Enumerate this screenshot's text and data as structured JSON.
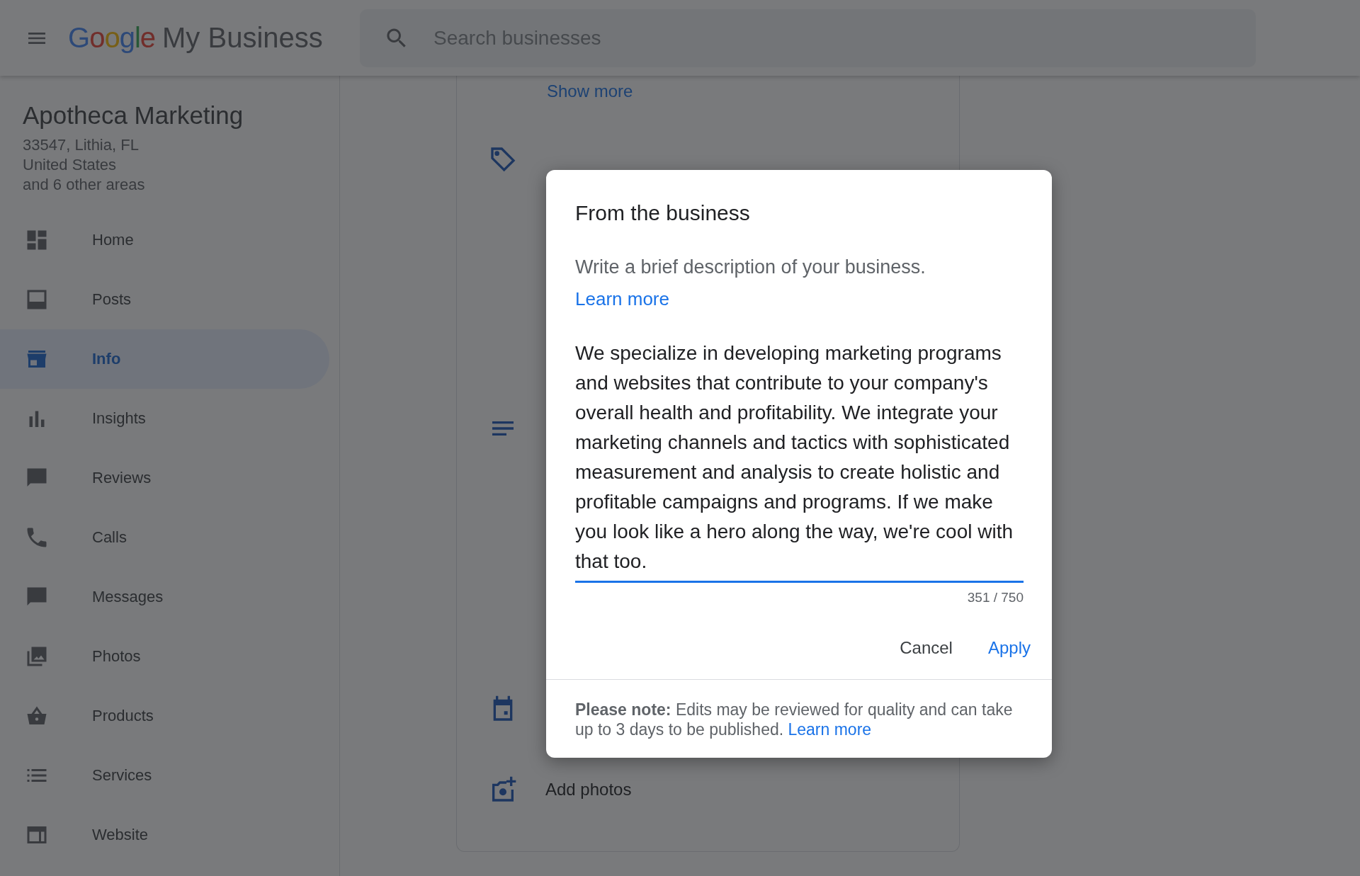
{
  "header": {
    "logo": {
      "brand": "Google",
      "product": "My Business"
    },
    "search": {
      "placeholder": "Search businesses"
    }
  },
  "business": {
    "name": "Apotheca Marketing",
    "address_lines": [
      "33547, Lithia, FL",
      "United States",
      "and 6 other areas"
    ]
  },
  "nav": [
    {
      "label": "Home",
      "selected": false
    },
    {
      "label": "Posts",
      "selected": false
    },
    {
      "label": "Info",
      "selected": true
    },
    {
      "label": "Insights",
      "selected": false
    },
    {
      "label": "Reviews",
      "selected": false
    },
    {
      "label": "Calls",
      "selected": false
    },
    {
      "label": "Messages",
      "selected": false
    },
    {
      "label": "Photos",
      "selected": false
    },
    {
      "label": "Products",
      "selected": false
    },
    {
      "label": "Services",
      "selected": false
    },
    {
      "label": "Website",
      "selected": false
    }
  ],
  "info_card": {
    "show_more": "Show more",
    "add_photos": "Add photos"
  },
  "dialog": {
    "title": "From the business",
    "description": "Write a brief description of your business.",
    "learn_more": "Learn more",
    "value": "We specialize in developing marketing programs and websites that contribute to your company's overall health and profitability. We integrate your marketing channels and tactics with sophisticated measurement and analysis to create holistic and profitable campaigns and programs. If we make you look like a hero along the way, we're cool with that too.",
    "counter": "351 / 750",
    "buttons": [
      {
        "label": "Cancel",
        "kind": "secondary"
      },
      {
        "label": "Apply",
        "kind": "primary"
      }
    ],
    "note": {
      "text": "**Please note:** Edits may be reviewed for quality and can take up to 3 days to be published.",
      "link": "Learn more"
    }
  }
}
